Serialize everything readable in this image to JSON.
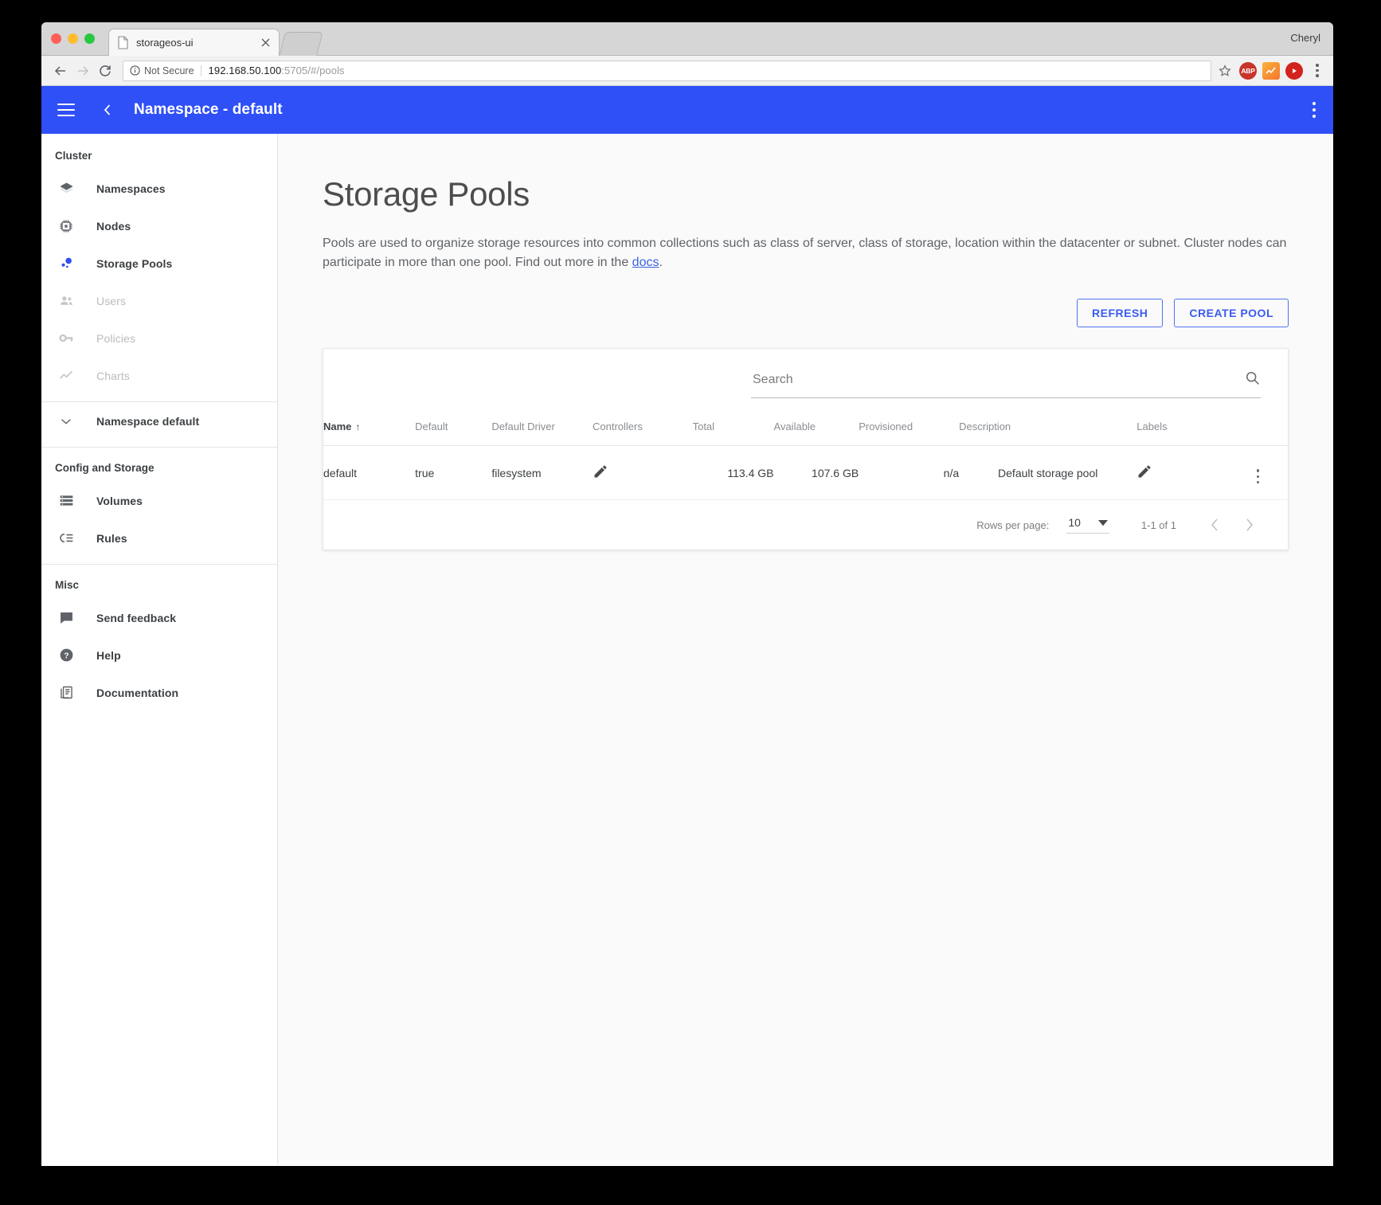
{
  "browser": {
    "tab_title": "storageos-ui",
    "profile_name": "Cheryl",
    "security_label": "Not Secure",
    "url_host": "192.168.50.100",
    "url_path": ":5705/#/pools",
    "extensions": [
      "abp-extension-icon",
      "chart-extension-icon",
      "play-extension-icon"
    ]
  },
  "appbar": {
    "title": "Namespace - default"
  },
  "sidebar": {
    "sections": [
      {
        "label": "Cluster"
      },
      {
        "label": "Config and Storage"
      },
      {
        "label": "Misc"
      }
    ],
    "cluster_items": [
      {
        "label": "Namespaces",
        "icon": "layers-icon",
        "state": "enabled"
      },
      {
        "label": "Nodes",
        "icon": "cpu-chip-icon",
        "state": "enabled"
      },
      {
        "label": "Storage Pools",
        "icon": "storage-pools-icon",
        "state": "active"
      },
      {
        "label": "Users",
        "icon": "people-icon",
        "state": "disabled"
      },
      {
        "label": "Policies",
        "icon": "key-icon",
        "state": "disabled"
      },
      {
        "label": "Charts",
        "icon": "trending-line-icon",
        "state": "disabled"
      }
    ],
    "namespace_expander": {
      "label": "Namespace default",
      "icon": "chevron-down-icon"
    },
    "config_items": [
      {
        "label": "Volumes",
        "icon": "storage-list-icon",
        "state": "enabled"
      },
      {
        "label": "Rules",
        "icon": "rules-icon",
        "state": "enabled"
      }
    ],
    "misc_items": [
      {
        "label": "Send feedback",
        "icon": "feedback-icon",
        "state": "enabled"
      },
      {
        "label": "Help",
        "icon": "help-circle-icon",
        "state": "enabled"
      },
      {
        "label": "Documentation",
        "icon": "documentation-icon",
        "state": "enabled"
      }
    ]
  },
  "main": {
    "title": "Storage Pools",
    "description_before_link": "Pools are used to organize storage resources into common collections such as class of server, class of storage, location within the datacenter or subnet. Cluster nodes can participate in more than one pool. Find out more in the ",
    "description_link": "docs",
    "description_after_link": ".",
    "refresh_label": "REFRESH",
    "create_pool_label": "CREATE POOL",
    "search_placeholder": "Search",
    "search_value": "",
    "table": {
      "columns": [
        {
          "key": "name",
          "label": "Name",
          "sorted": true,
          "sort_dir": "↑"
        },
        {
          "key": "default",
          "label": "Default"
        },
        {
          "key": "driver",
          "label": "Default Driver"
        },
        {
          "key": "controllers",
          "label": "Controllers"
        },
        {
          "key": "total",
          "label": "Total"
        },
        {
          "key": "available",
          "label": "Available"
        },
        {
          "key": "provisioned",
          "label": "Provisioned"
        },
        {
          "key": "description",
          "label": "Description"
        },
        {
          "key": "labels",
          "label": "Labels"
        }
      ],
      "rows": [
        {
          "name": "default",
          "default": "true",
          "driver": "filesystem",
          "controllers_icon": "edit-pencil-icon",
          "total": "113.4 GB",
          "available": "107.6 GB",
          "provisioned": "n/a",
          "description": "Default storage pool",
          "labels_icon": "edit-pencil-icon",
          "menu_icon": "more-vertical-icon"
        }
      ]
    },
    "paginator": {
      "rows_per_page_label": "Rows per page:",
      "rows_per_page_value": "10",
      "range_label": "1-1 of 1"
    }
  },
  "colors": {
    "brand_blue": "#2f4ff7",
    "link_blue": "#3a63e0",
    "button_blue": "#3a5bef"
  }
}
